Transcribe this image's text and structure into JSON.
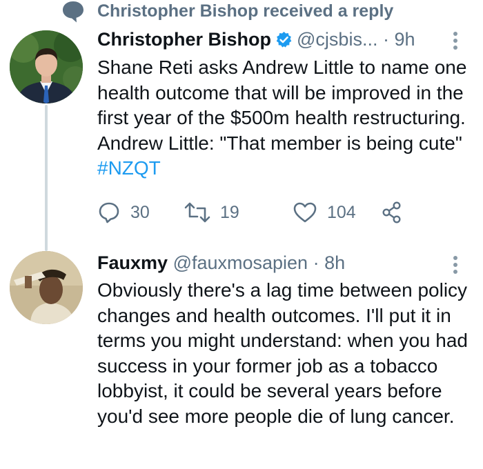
{
  "context": {
    "text": "Christopher Bishop received a reply",
    "icon": "speech-bubble-icon"
  },
  "tweet1": {
    "name": "Christopher Bishop",
    "handle": "@cjsbis...",
    "time": "· 9h",
    "verified_icon": "verified-badge-icon",
    "text_before": "Shane Reti asks Andrew Little to name one health outcome that will be improved in the first year of the $500m health restructuring. Andrew Little: \"That member is being cute\" ",
    "hashtag": "#NZQT",
    "actions": {
      "replies": "30",
      "retweets": "19",
      "likes": "104"
    }
  },
  "tweet2": {
    "name": "Fauxmy",
    "handle": "@fauxmosapien",
    "time": "· 8h",
    "text": "Obviously there's a lag time between policy changes and health outcomes. I'll put it in terms you might understand: when you had success in your former job as a tobacco lobbyist, it could be several years before you'd see more people die of lung cancer."
  },
  "colors": {
    "accent": "#1d9bf0",
    "muted": "#5b7083",
    "text": "#0f1419",
    "thread_line": "#cfd9de"
  }
}
